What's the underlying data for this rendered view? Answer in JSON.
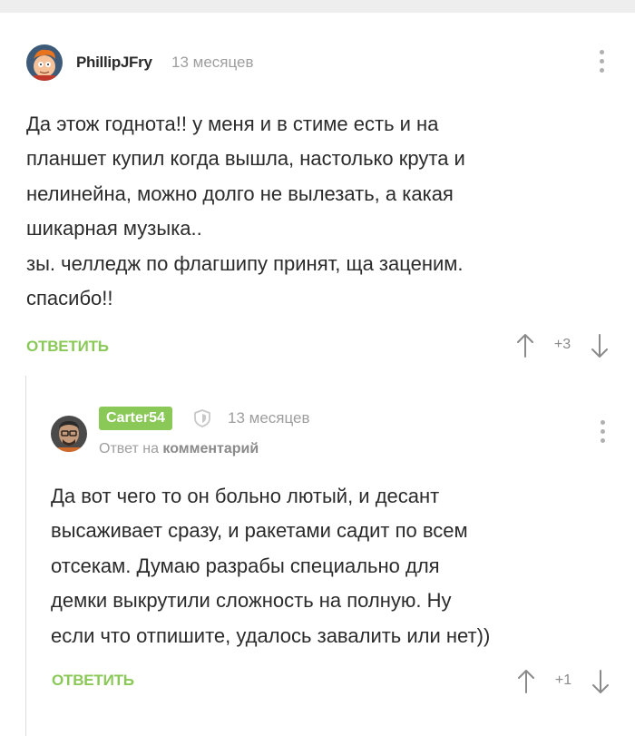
{
  "comments": [
    {
      "username": "PhillipJFry",
      "time": "13 месяцев",
      "body": "Да этож годнота!! у меня и в стиме есть и на\nпланшет купил когда вышла, настолько крута и\nнелинейна, можно долго не вылезать, а какая\nшикарная музыка..\nзы. челледж по флагшипу принят, ща заценим.\nспасибо!!",
      "reply_label": "ОТВЕТИТЬ",
      "rating": "+3"
    },
    {
      "username": "Carter54",
      "time": "13 месяцев",
      "reply_prefix": "Ответ на",
      "reply_target": "комментарий",
      "body": "Да вот чего то он больно лютый, и десант\nвысаживает сразу, и ракетами садит по всем\nотсекам. Думаю разрабы специально для\nдемки выкрутили сложность на полную. Ну\nесли что отпишите, удалось завалить или нет))",
      "reply_label": "ОТВЕТИТЬ",
      "rating": "+1"
    }
  ],
  "colors": {
    "accent": "#8ac858",
    "text": "#2b2b2b",
    "muted": "#9e9e9e"
  },
  "icons": [
    "avatar-image",
    "shield-icon",
    "more-vertical-icon",
    "arrow-up-icon",
    "arrow-down-icon"
  ]
}
